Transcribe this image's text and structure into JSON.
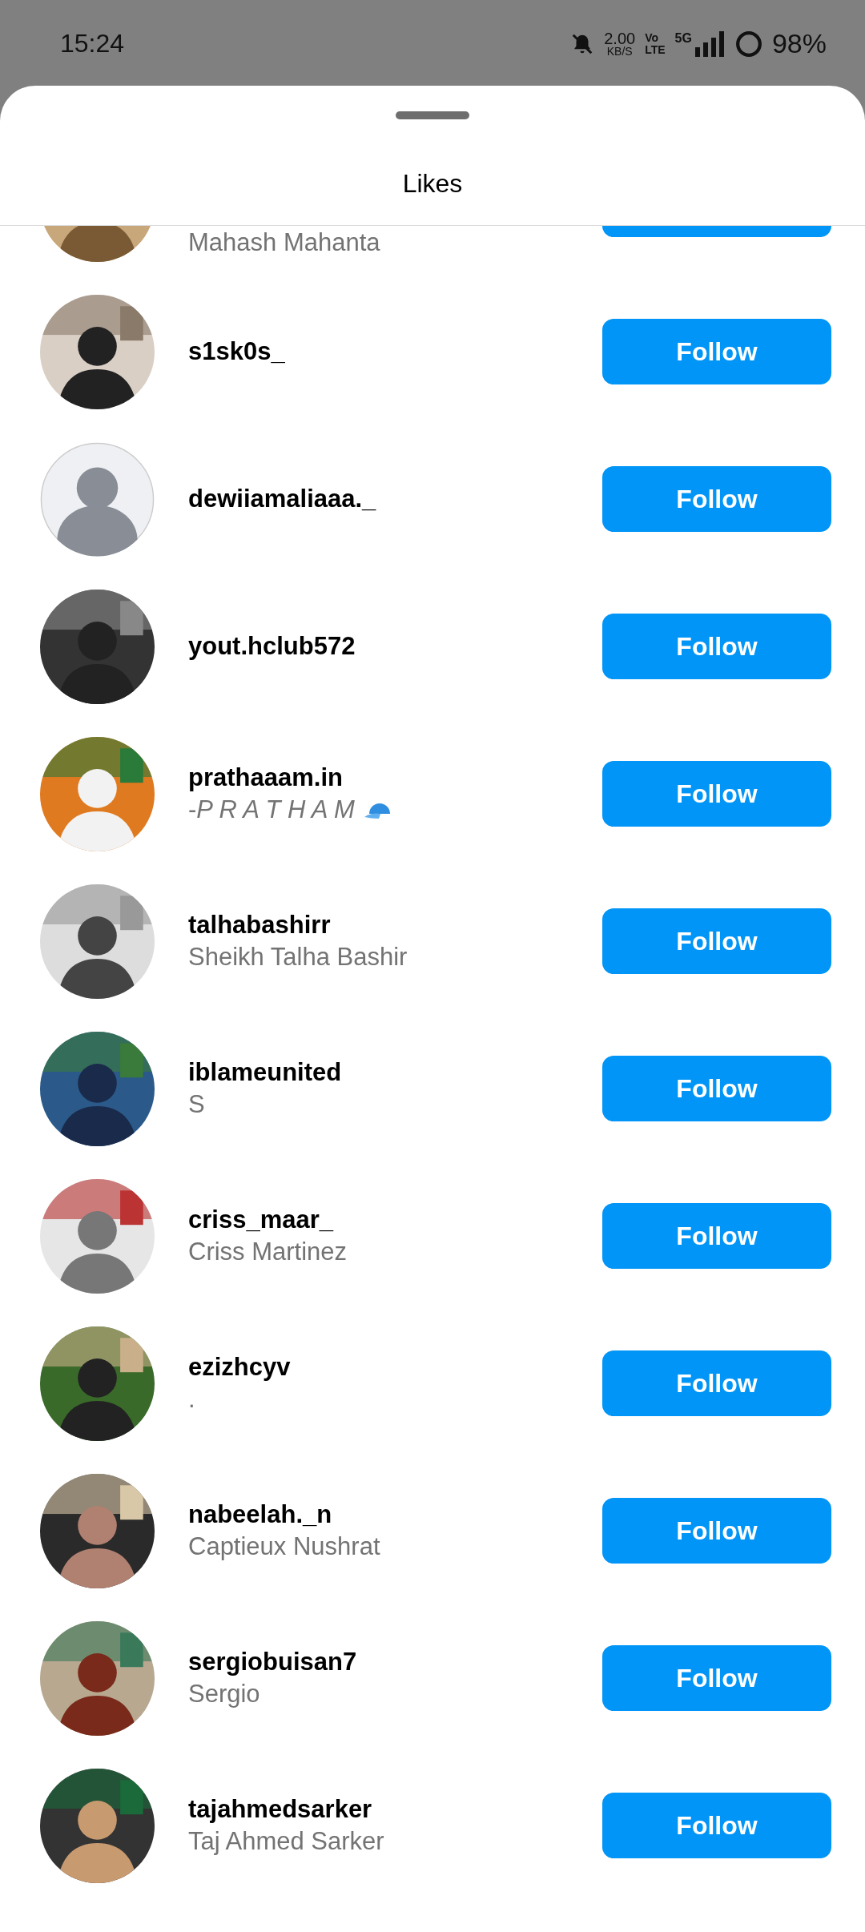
{
  "status_bar": {
    "time": "15:24",
    "speed": "2.00",
    "speed_unit": "KB/S",
    "volte_top": "Vo",
    "volte_bottom": "LTE",
    "network": "5G",
    "battery": "98%"
  },
  "sheet": {
    "title": "Likes"
  },
  "users": [
    {
      "kind": "picture",
      "subtitle": "Mahash Mahanta"
    },
    {
      "kind": "picture",
      "username": "s1sk0s_",
      "button": "Follow"
    },
    {
      "kind": "default",
      "username": "dewiiamaliaaa._",
      "button": "Follow"
    },
    {
      "kind": "picture",
      "username": "yout.hclub572",
      "button": "Follow"
    },
    {
      "kind": "picture",
      "username": "prathaaam.in",
      "subtitle": "-*P R A T H A M*",
      "cap_emoji": true,
      "button": "Follow"
    },
    {
      "kind": "picture",
      "username": "talhabashirr",
      "subtitle": "Sheikh Talha Bashir",
      "button": "Follow"
    },
    {
      "kind": "picture",
      "username": "iblameunited",
      "subtitle": "S",
      "button": "Follow"
    },
    {
      "kind": "picture",
      "username": "criss_maar_",
      "subtitle": "Criss Martinez",
      "button": "Follow"
    },
    {
      "kind": "picture",
      "username": "ezizhcyv",
      "subtitle": ".",
      "button": "Follow"
    },
    {
      "kind": "picture",
      "username": "nabeelah._n",
      "subtitle": "Captieux Nushrat",
      "button": "Follow"
    },
    {
      "kind": "picture",
      "username": "sergiobuisan7",
      "subtitle": "Sergio",
      "button": "Follow"
    },
    {
      "kind": "picture",
      "username": "tajahmedsarker",
      "subtitle": "Taj Ahmed Sarker",
      "button": "Follow"
    }
  ]
}
